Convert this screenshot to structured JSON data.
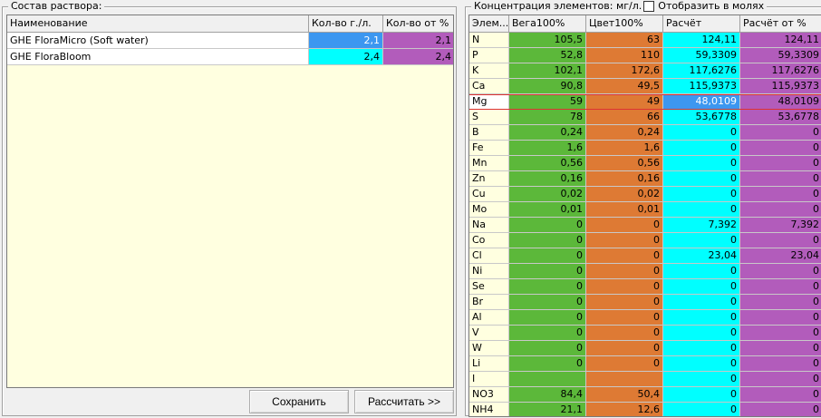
{
  "colors": {
    "green": "#5cb83a",
    "orange": "#de7a34",
    "cyan": "#00ffff",
    "purple": "#b25cbb",
    "blue": "#3c97f0",
    "selected_name_bg": "#ffffff"
  },
  "left_panel": {
    "title": "Состав раствора:",
    "columns": [
      "Наименование",
      "Кол-во г./л.",
      "Кол-во от %"
    ],
    "rows": [
      {
        "name": "GHE FloraMicro (Soft water)",
        "qty": "2,1",
        "pct": "2,1"
      },
      {
        "name": "GHE FloraBloom",
        "qty": "2,4",
        "pct": "2,4"
      }
    ],
    "save_label": "Сохранить",
    "calc_label": "Рассчитать >>"
  },
  "right_panel": {
    "title": "Концентрация элементов: мг/л.",
    "checkbox_label": "Отобразить в молях",
    "columns": [
      "Элем...",
      "Вега100%",
      "Цвет100%",
      "Расчёт",
      "Расчёт от %"
    ],
    "rows": [
      {
        "el": "N",
        "a": "105,5",
        "b": "63",
        "c": "124,11",
        "d": "124,11"
      },
      {
        "el": "P",
        "a": "52,8",
        "b": "110",
        "c": "59,3309",
        "d": "59,3309"
      },
      {
        "el": "K",
        "a": "102,1",
        "b": "172,6",
        "c": "117,6276",
        "d": "117,6276"
      },
      {
        "el": "Ca",
        "a": "90,8",
        "b": "49,5",
        "c": "115,9373",
        "d": "115,9373"
      },
      {
        "el": "Mg",
        "a": "59",
        "b": "49",
        "c": "48,0109",
        "d": "48,0109"
      },
      {
        "el": "S",
        "a": "78",
        "b": "66",
        "c": "53,6778",
        "d": "53,6778"
      },
      {
        "el": "B",
        "a": "0,24",
        "b": "0,24",
        "c": "0",
        "d": "0"
      },
      {
        "el": "Fe",
        "a": "1,6",
        "b": "1,6",
        "c": "0",
        "d": "0"
      },
      {
        "el": "Mn",
        "a": "0,56",
        "b": "0,56",
        "c": "0",
        "d": "0"
      },
      {
        "el": "Zn",
        "a": "0,16",
        "b": "0,16",
        "c": "0",
        "d": "0"
      },
      {
        "el": "Cu",
        "a": "0,02",
        "b": "0,02",
        "c": "0",
        "d": "0"
      },
      {
        "el": "Mo",
        "a": "0,01",
        "b": "0,01",
        "c": "0",
        "d": "0"
      },
      {
        "el": "Na",
        "a": "0",
        "b": "0",
        "c": "7,392",
        "d": "7,392"
      },
      {
        "el": "Co",
        "a": "0",
        "b": "0",
        "c": "0",
        "d": "0"
      },
      {
        "el": "Cl",
        "a": "0",
        "b": "0",
        "c": "23,04",
        "d": "23,04"
      },
      {
        "el": "Ni",
        "a": "0",
        "b": "0",
        "c": "0",
        "d": "0"
      },
      {
        "el": "Se",
        "a": "0",
        "b": "0",
        "c": "0",
        "d": "0"
      },
      {
        "el": "Br",
        "a": "0",
        "b": "0",
        "c": "0",
        "d": "0"
      },
      {
        "el": "Al",
        "a": "0",
        "b": "0",
        "c": "0",
        "d": "0"
      },
      {
        "el": "V",
        "a": "0",
        "b": "0",
        "c": "0",
        "d": "0"
      },
      {
        "el": "W",
        "a": "0",
        "b": "0",
        "c": "0",
        "d": "0"
      },
      {
        "el": "Li",
        "a": "0",
        "b": "0",
        "c": "0",
        "d": "0"
      },
      {
        "el": "I",
        "a": "",
        "b": "",
        "c": "0",
        "d": "0"
      },
      {
        "el": "NO3",
        "a": "84,4",
        "b": "50,4",
        "c": "0",
        "d": "0"
      },
      {
        "el": "NH4",
        "a": "21,1",
        "b": "12,6",
        "c": "0",
        "d": "0"
      }
    ]
  }
}
